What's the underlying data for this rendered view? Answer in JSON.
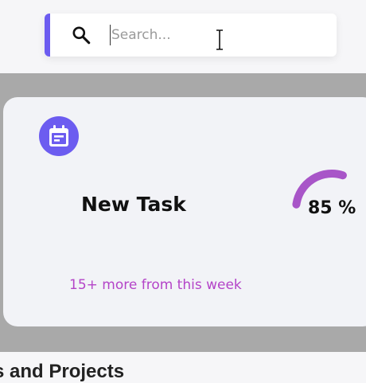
{
  "search": {
    "placeholder": "Search...",
    "icon": "search-icon",
    "accent_color": "#6c5cf0"
  },
  "task_card": {
    "icon": "calendar-icon",
    "icon_bg": "#6c5cf0",
    "title": "New Task",
    "progress_percent": 85,
    "progress_label": "85 %",
    "progress_color": "#a855c8",
    "more_link": "15+ more from this week",
    "more_link_color": "#b444c8"
  },
  "section": {
    "heading": "s and Projects"
  }
}
